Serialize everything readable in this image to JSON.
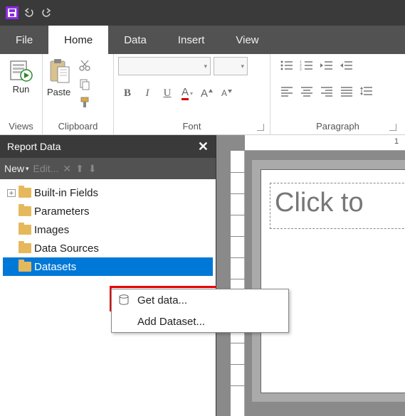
{
  "titlebar": {
    "save_icon": "save-icon",
    "undo_icon": "undo-icon",
    "redo_icon": "redo-icon"
  },
  "menutabs": {
    "file": "File",
    "home": "Home",
    "data": "Data",
    "insert": "Insert",
    "view": "View",
    "active": "home"
  },
  "ribbon": {
    "views": {
      "run_label": "Run",
      "group_label": "Views"
    },
    "clipboard": {
      "paste_label": "Paste",
      "group_label": "Clipboard"
    },
    "font": {
      "group_label": "Font",
      "bold": "B",
      "italic": "I",
      "underline": "U",
      "font_color": "A",
      "size_up": "A",
      "size_down": "A"
    },
    "paragraph": {
      "group_label": "Paragraph"
    }
  },
  "report_data": {
    "title": "Report Data",
    "toolbar": {
      "new": "New",
      "edit": "Edit..."
    },
    "tree": {
      "builtin": "Built-in Fields",
      "parameters": "Parameters",
      "images": "Images",
      "datasources": "Data Sources",
      "datasets": "Datasets"
    }
  },
  "context_menu": {
    "get_data": "Get data...",
    "add_dataset": "Add Dataset..."
  },
  "canvas": {
    "placeholder": "Click to",
    "ruler_mark": "1"
  }
}
